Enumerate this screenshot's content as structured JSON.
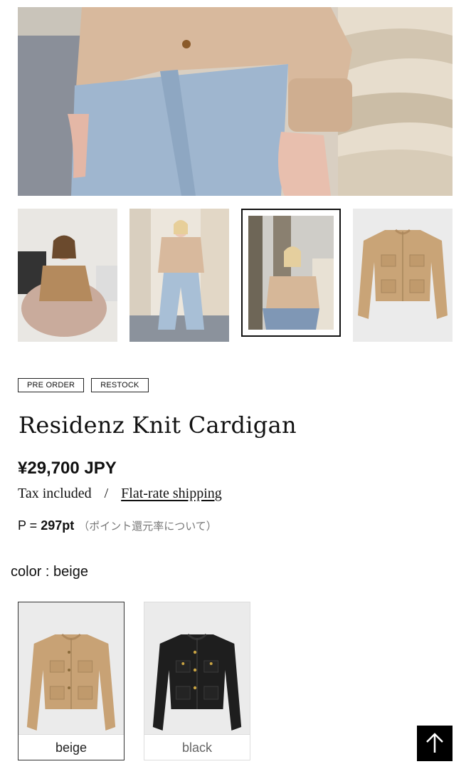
{
  "product": {
    "tags": [
      "PRE ORDER",
      "RESTOCK"
    ],
    "title": "Residenz Knit Cardigan",
    "price": "¥29,700 JPY",
    "tax_text": "Tax included",
    "separator": "/",
    "shipping_link": "Flat-rate shipping",
    "points_prefix": "P = ",
    "points_value": "297pt",
    "points_link": "（ポイント還元率について）"
  },
  "gallery": {
    "selected_thumb_index": 2,
    "thumbnail_count": 4
  },
  "color": {
    "label": "color : beige",
    "options": [
      {
        "name": "beige",
        "selected": true,
        "garment_color": "#c8a275"
      },
      {
        "name": "black",
        "selected": false,
        "garment_color": "#1e1e1e"
      }
    ]
  },
  "colors": {
    "text": "#111111",
    "muted": "#777777",
    "border": "#222222",
    "button_bg": "#000000"
  },
  "icons": {
    "back_to_top": "arrow-up-icon"
  }
}
